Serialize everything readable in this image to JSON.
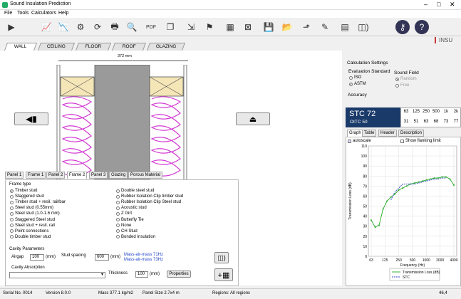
{
  "window": {
    "title": "Sound Insulation Prediction"
  },
  "menu": [
    "File",
    "Tools",
    "Calculators",
    "Help"
  ],
  "toolbar_icons": [
    "run-icon",
    "graph-icon",
    "graph2-icon",
    "gear-icon",
    "refresh-icon",
    "print-icon",
    "preview-icon",
    "pdf-icon",
    "copy-icon",
    "export-icon",
    "flag-icon",
    "image-icon",
    "clear-icon",
    "save-icon",
    "open-icon",
    "export2-icon",
    "edit-icon",
    "calculator-icon",
    "sound-icon",
    "key-icon",
    "help-icon"
  ],
  "brand": "INSU",
  "tabs": [
    "WALL",
    "CEILING",
    "FLOOR",
    "ROOF",
    "GLAZING"
  ],
  "dimension": "372 mm",
  "subtabs": [
    "Panel 1",
    "Frame 1",
    "Panel 2",
    "Frame 2",
    "Panel 3",
    "Glazing",
    "Porous Material"
  ],
  "frame_type_label": "Frame type",
  "frame_types_left": [
    "Timber stud",
    "Staggered stud",
    "Timber stud + resil. rail/bar",
    "Steel stud (0.55mm)",
    "Steel stud (1.0-1.6 mm)",
    "Staggered Steel stud",
    "Steel stud + resil. rail",
    "Point connections",
    "Double timber stud"
  ],
  "frame_types_right": [
    "Double steel stud",
    "Rubber Isolation Clip timber stud",
    "Rubber Isolation Clip Steel stud",
    "Acoustic stud",
    "Z Girt",
    "Butterfly Tie",
    "None",
    "CH Stud",
    "Bonded Insulation"
  ],
  "cavity": {
    "label": "Cavity Parameters",
    "airgap_label": "Airgap",
    "airgap": "100",
    "mm": "(mm)",
    "spacing_label": "Stud spacing",
    "spacing": "600",
    "mam1": "Mass-air-mass 71Hz",
    "mam2": "Mass-air-mass 73Hz",
    "absorption_label": "Cavity Absorption",
    "thickness_label": "Thickness",
    "thickness": "100",
    "properties": "Properties"
  },
  "calc": {
    "title": "Calculation Settings",
    "eval_label": "Evaluation Standard",
    "iso": "ISO",
    "astm": "ASTM",
    "field_label": "Sound Field",
    "random": "Random",
    "free": "Free",
    "accuracy": "Accuracy"
  },
  "stc": {
    "stc": "STC 72",
    "oitc": "OITC 50",
    "freqs": [
      "63",
      "125",
      "250",
      "500",
      "1k",
      "2k"
    ],
    "vals": [
      "31",
      "51",
      "63",
      "68",
      "73",
      "77"
    ]
  },
  "graph_tabs": [
    "Graph",
    "Table",
    "Header",
    "Description"
  ],
  "autoscale": "autoscale",
  "flanking": "Show flanking limit",
  "status": {
    "serial": "Serial No. 0014",
    "version": "Version 8.0.0",
    "mass": "Mass 377.1 kg/m2",
    "panel": "Panel Size 2.7x4 m",
    "regions": "Regions: All regions",
    "coord": "46,4"
  },
  "chart_data": {
    "type": "line",
    "ylabel": "Transmission Loss (dB)",
    "xlabel": "Frequency (Hz)",
    "ylim": [
      0,
      110
    ],
    "yticks": [
      0,
      10,
      20,
      30,
      40,
      50,
      60,
      70,
      80,
      90,
      100,
      110
    ],
    "xticks": [
      "63",
      "125",
      "250",
      "500",
      "1000",
      "2000",
      "4000"
    ],
    "series": [
      {
        "name": "Transmission Loss (dB)",
        "color": "#22aa22",
        "values": [
          36,
          29,
          31,
          47,
          55,
          59,
          62,
          66,
          68,
          70,
          72,
          73,
          74,
          75,
          76,
          77,
          78,
          78,
          79,
          79,
          77,
          71
        ]
      },
      {
        "name": "STC",
        "color": "#3344cc",
        "values": [
          null,
          null,
          null,
          null,
          null,
          56,
          64,
          68,
          72,
          72,
          72,
          72,
          73,
          74,
          75,
          76,
          77,
          77,
          78,
          78,
          null,
          null
        ]
      }
    ]
  }
}
